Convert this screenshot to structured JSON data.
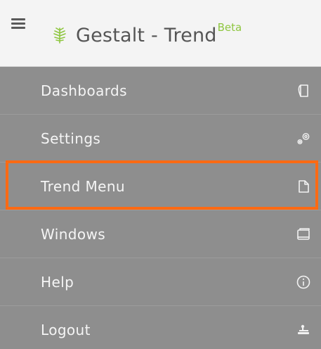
{
  "header": {
    "app_name": "Gestalt - Trend",
    "superscript": "Beta",
    "menu_icon": "hamburger-icon",
    "logo_icon": "leaf-logo-icon",
    "accent_color": "#8ec63f",
    "background_color": "#f4f4f4"
  },
  "menu": {
    "background_color": "#8e8e8e",
    "items": [
      {
        "label": "Dashboards",
        "icon": "document-icon"
      },
      {
        "label": "Settings",
        "icon": "gears-icon"
      },
      {
        "label": "Trend Menu",
        "icon": "file-icon",
        "highlighted": true
      },
      {
        "label": "Windows",
        "icon": "windows-stack-icon"
      },
      {
        "label": "Help",
        "icon": "info-icon"
      },
      {
        "label": "Logout",
        "icon": "logout-icon"
      }
    ]
  },
  "highlight": {
    "color": "#ff6a13",
    "target": "Trend Menu"
  }
}
